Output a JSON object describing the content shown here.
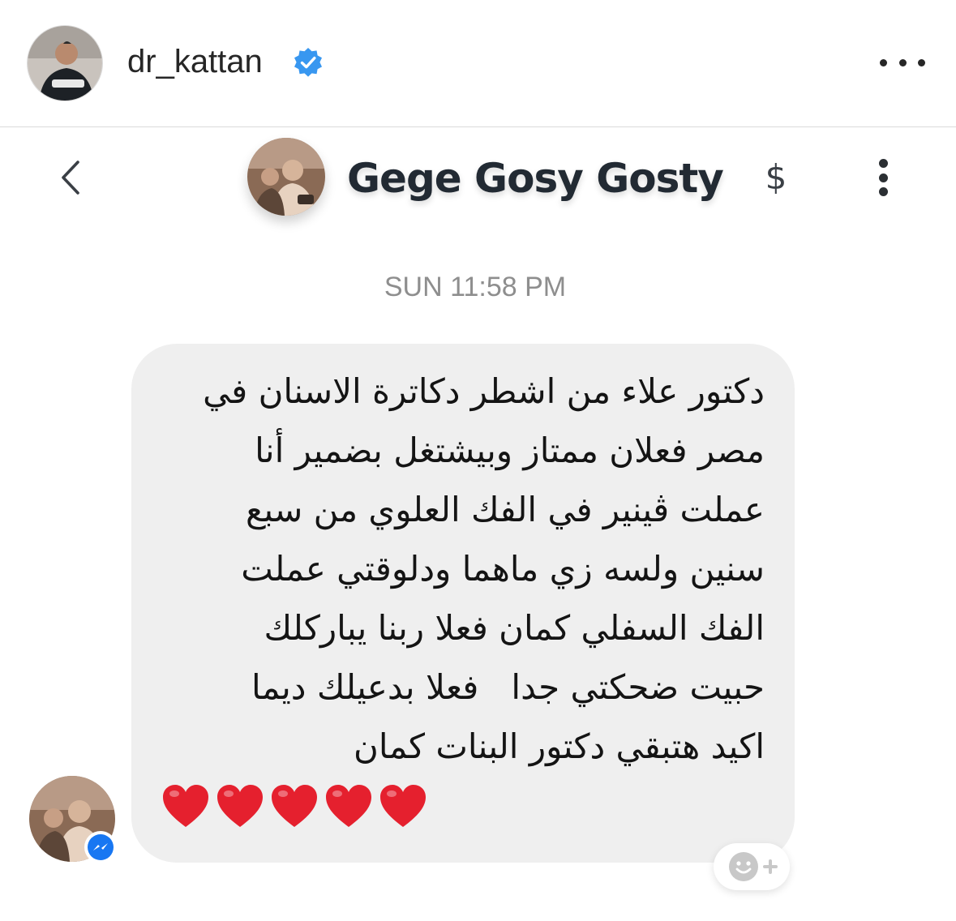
{
  "post_header": {
    "username": "dr_kattan",
    "verified": true,
    "verified_icon": "verified-badge-icon",
    "more_icon": "more-horizontal-icon"
  },
  "chat": {
    "back_icon": "chevron-left-icon",
    "contact_name": "Gege Gosy Gosty",
    "payment_symbol": "$",
    "menu_icon": "more-vertical-icon",
    "timestamp": "SUN 11:58 PM",
    "message_lines": [
      "دكتور علاء من اشطر دكاترة الاسنان في",
      "مصر فعلان ممتاز وبيشتغل بضمير أنا",
      "عملت ڤينير في الفك العلوي من سبع",
      "سنين ولسه زي ماهما ودلوقتي عملت",
      "الفك السفلي كمان فعلا ربنا يباركلك",
      "حبيت ضحكتي جدا   فعلا بدعيلك ديما",
      "اكيد هتبقي دكتور البنات كمان"
    ],
    "heart_count": 5,
    "heart_color": "#e5202e",
    "reaction_icon": "add-reaction-icon",
    "messenger_icon": "messenger-icon"
  },
  "colors": {
    "verified_blue": "#3897f0",
    "bubble_bg": "#efefef",
    "messenger_blue": "#1877f2"
  }
}
